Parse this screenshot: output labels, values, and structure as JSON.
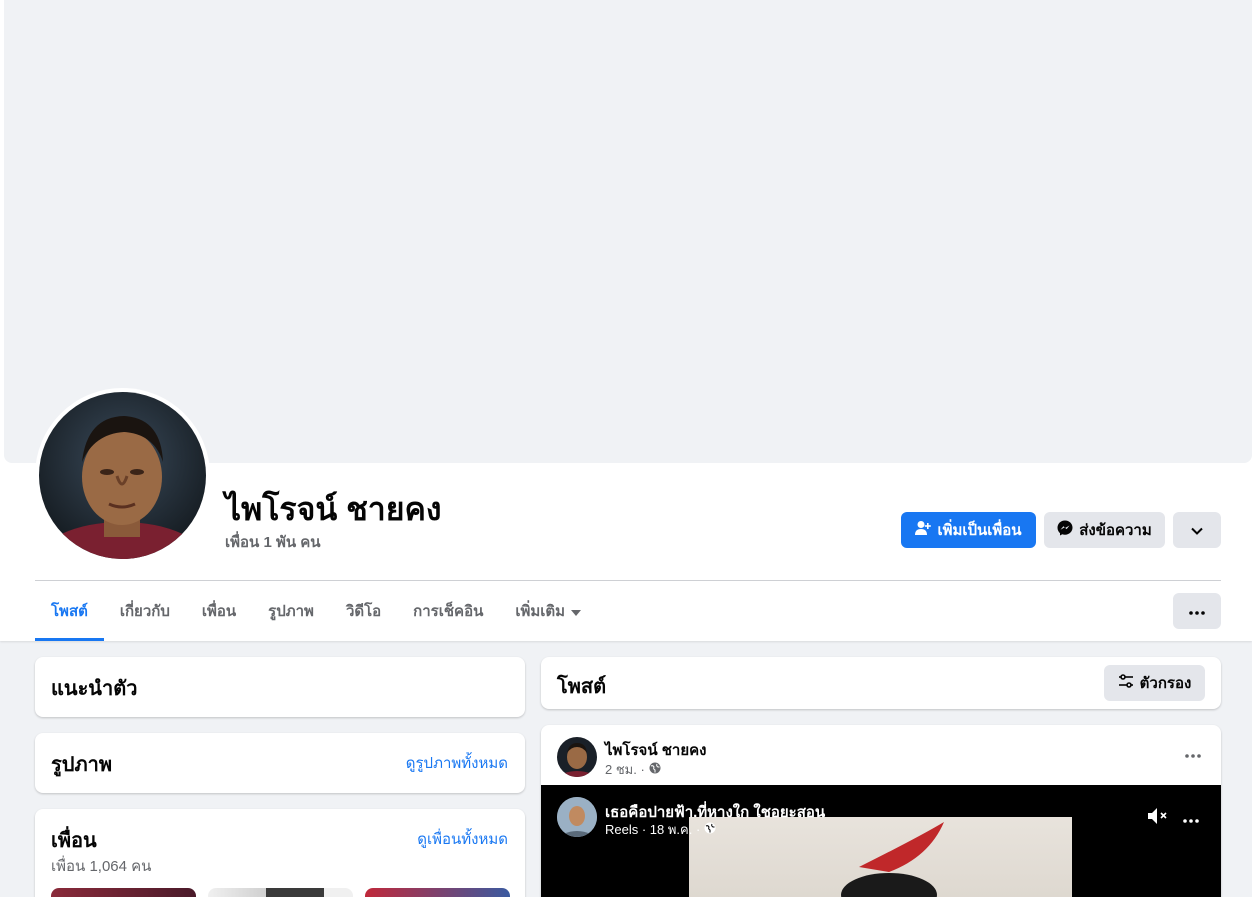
{
  "profile": {
    "name": "ไพโรจน์ ชายคง",
    "friends_summary": "เพื่อน 1 พัน คน"
  },
  "actions": {
    "add_friend": "เพิ่มเป็นเพื่อน",
    "message": "ส่งข้อความ"
  },
  "tabs": [
    {
      "label": "โพสต์",
      "active": true
    },
    {
      "label": "เกี่ยวกับ"
    },
    {
      "label": "เพื่อน"
    },
    {
      "label": "รูปภาพ"
    },
    {
      "label": "วิดีโอ"
    },
    {
      "label": "การเช็คอิน"
    },
    {
      "label": "เพิ่มเติม"
    }
  ],
  "intro": {
    "title": "แนะนำตัว"
  },
  "photos": {
    "title": "รูปภาพ",
    "link": "ดูรูปภาพทั้งหมด"
  },
  "friends": {
    "title": "เพื่อน",
    "link": "ดูเพื่อนทั้งหมด",
    "count": "เพื่อน 1,064 คน"
  },
  "posts": {
    "title": "โพสต์",
    "filter": "ตัวกรอง"
  },
  "post": {
    "author": "ไพโรจน์ ชายคง",
    "time": "2 ชม. ·",
    "reel": {
      "title": "เธอคือปายฟ้า.ที่หางใก ใชอยะสอน",
      "meta": "Reels · 18 พ.ค. ·"
    }
  },
  "colors": {
    "accent": "#1877f2",
    "secondary_btn": "#e4e6eb",
    "background": "#f0f2f5"
  }
}
